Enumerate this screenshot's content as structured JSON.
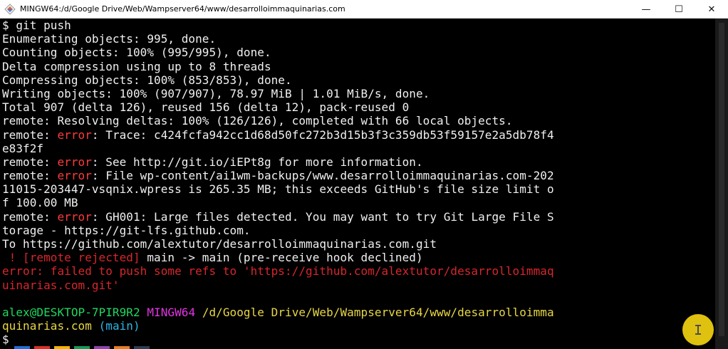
{
  "window": {
    "title": "MINGW64:/d/Google Drive/Web/Wampserver64/www/desarrolloimmaquinarias.com",
    "minimize_glyph": "—",
    "maximize_glyph": "☐",
    "close_glyph": "✕",
    "icon": "mingw-terminal-icon"
  },
  "terminal": {
    "lines": [
      [
        {
          "t": "$ git push",
          "c": ""
        }
      ],
      [
        {
          "t": "Enumerating objects: 995, done.",
          "c": ""
        }
      ],
      [
        {
          "t": "Counting objects: 100% (995/995), done.",
          "c": ""
        }
      ],
      [
        {
          "t": "Delta compression using up to 8 threads",
          "c": ""
        }
      ],
      [
        {
          "t": "Compressing objects: 100% (853/853), done.",
          "c": ""
        }
      ],
      [
        {
          "t": "Writing objects: 100% (907/907), 78.97 MiB | 1.01 MiB/s, done.",
          "c": ""
        }
      ],
      [
        {
          "t": "Total 907 (delta 126), reused 156 (delta 12), pack-reused 0",
          "c": ""
        }
      ],
      [
        {
          "t": "remote: Resolving deltas: 100% (126/126), completed with 66 local objects.",
          "c": ""
        }
      ],
      [
        {
          "t": "remote: ",
          "c": ""
        },
        {
          "t": "error",
          "c": "err"
        },
        {
          "t": ": Trace: c424fcfa942cc1d68d50fc272b3d15b3f3c359db53f59157e2a5db78f4",
          "c": ""
        }
      ],
      [
        {
          "t": "e83f2f",
          "c": ""
        }
      ],
      [
        {
          "t": "remote: ",
          "c": ""
        },
        {
          "t": "error",
          "c": "err"
        },
        {
          "t": ": See http://git.io/iEPt8g for more information.",
          "c": ""
        }
      ],
      [
        {
          "t": "remote: ",
          "c": ""
        },
        {
          "t": "error",
          "c": "err"
        },
        {
          "t": ": File wp-content/ai1wm-backups/www.desarrolloimmaquinarias.com-202",
          "c": ""
        }
      ],
      [
        {
          "t": "11015-203447-vsqnix.wpress is 265.35 MB; this exceeds GitHub's file size limit o",
          "c": ""
        }
      ],
      [
        {
          "t": "f 100.00 MB",
          "c": ""
        }
      ],
      [
        {
          "t": "remote: ",
          "c": ""
        },
        {
          "t": "error",
          "c": "err"
        },
        {
          "t": ": GH001: Large files detected. You may want to try Git Large File S",
          "c": ""
        }
      ],
      [
        {
          "t": "torage - https://git-lfs.github.com.",
          "c": ""
        }
      ],
      [
        {
          "t": "To https://github.com/alextutor/desarrolloimmaquinarias.com.git",
          "c": ""
        }
      ],
      [
        {
          "t": " ! [remote rejected]",
          "c": "red"
        },
        {
          "t": " main -> main (pre-receive hook declined)",
          "c": ""
        }
      ],
      [
        {
          "t": "error: failed to push some refs to 'https://github.com/alextutor/desarrolloimmaq",
          "c": "red"
        }
      ],
      [
        {
          "t": "uinarias.com.git'",
          "c": "red"
        }
      ],
      [
        {
          "t": "",
          "c": ""
        }
      ],
      [
        {
          "t": "alex@DESKTOP-7PIR9R2",
          "c": "green"
        },
        {
          "t": " ",
          "c": ""
        },
        {
          "t": "MINGW64",
          "c": "magenta"
        },
        {
          "t": " ",
          "c": ""
        },
        {
          "t": "/d/Google Drive/Web/Wampserver64/www/desarrolloimma",
          "c": "yellow"
        }
      ],
      [
        {
          "t": "quinarias.com",
          "c": "yellow"
        },
        {
          "t": " ",
          "c": ""
        },
        {
          "t": "(main)",
          "c": "cyan"
        }
      ],
      [
        {
          "t": "$",
          "c": ""
        }
      ]
    ]
  },
  "colors": {
    "background": "#000000",
    "text": "#f0f0f0",
    "error": "#ff3b3b",
    "user_host": "#1ed760",
    "mingw": "#e234e2",
    "path": "#e8d744",
    "branch": "#2ab7e8",
    "cursor_highlight": "#f2d211"
  },
  "taskbar_colors": [
    "#1e6fd9",
    "#d93025",
    "#f4b400",
    "#0f9d58",
    "#8e44ad",
    "#e67e22",
    "#2c3e50"
  ]
}
